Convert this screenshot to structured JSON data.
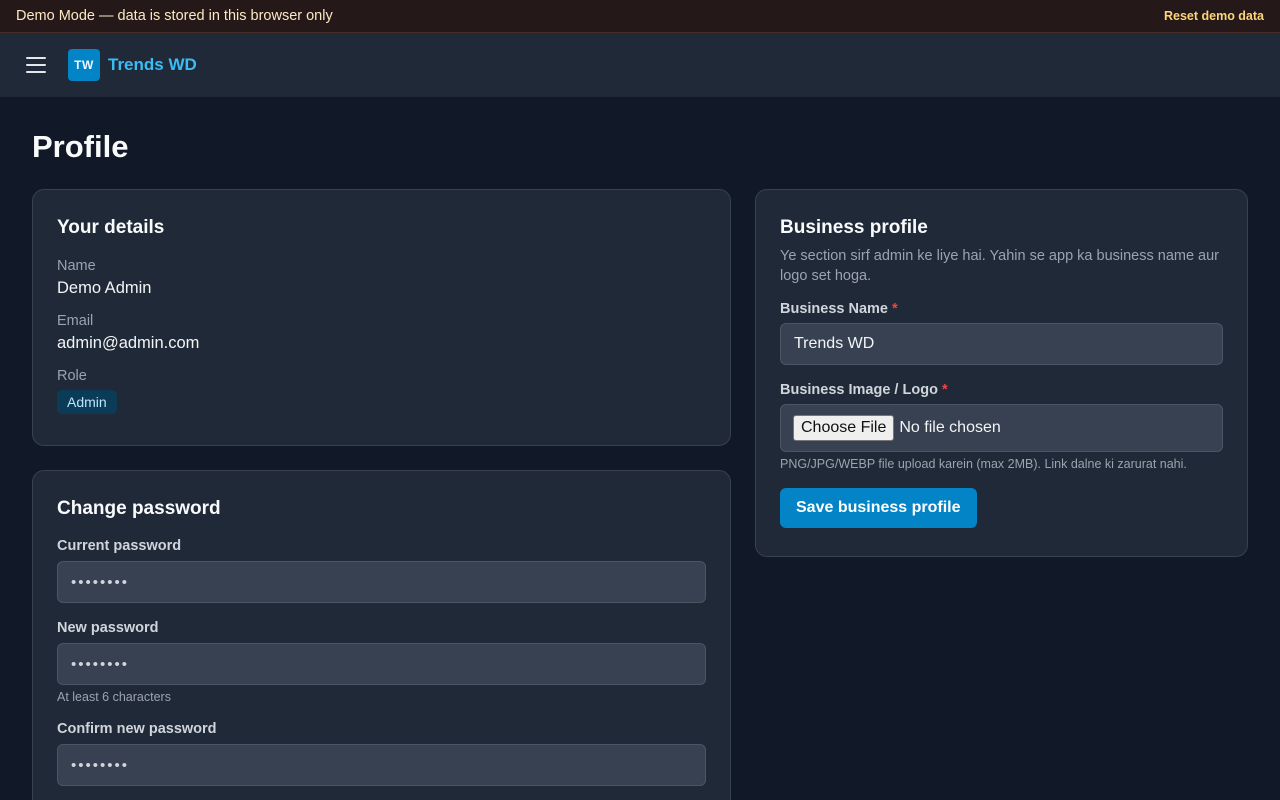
{
  "demo_banner": {
    "text": "Demo Mode — data is stored in this browser only",
    "reset_label": "Reset demo data"
  },
  "header": {
    "logo_initials": "TW",
    "brand_name": "Trends WD"
  },
  "page": {
    "title": "Profile"
  },
  "details": {
    "title": "Your details",
    "name_label": "Name",
    "name_value": "Demo Admin",
    "email_label": "Email",
    "email_value": "admin@admin.com",
    "role_label": "Role",
    "role_value": "Admin"
  },
  "password": {
    "title": "Change password",
    "current_label": "Current password",
    "current_placeholder": "••••••••",
    "new_label": "New password",
    "new_placeholder": "••••••••",
    "new_hint": "At least 6 characters",
    "confirm_label": "Confirm new password",
    "confirm_placeholder": "••••••••"
  },
  "business": {
    "title": "Business profile",
    "description": "Ye section sirf admin ke liye hai. Yahin se app ka business name aur logo set hoga.",
    "name_label": "Business Name",
    "name_value": "Trends WD",
    "image_label": "Business Image / Logo",
    "required_mark": "*",
    "file_button_label": "Choose File",
    "file_status": "No file chosen",
    "file_hint": "PNG/JPG/WEBP file upload karein (max 2MB). Link dalne ki zarurat nahi.",
    "save_label": "Save business profile"
  },
  "colors": {
    "background": "#111827",
    "card": "#1f2937",
    "accent": "#0284c7",
    "brand_text": "#38bdf8",
    "required": "#ef4444"
  }
}
